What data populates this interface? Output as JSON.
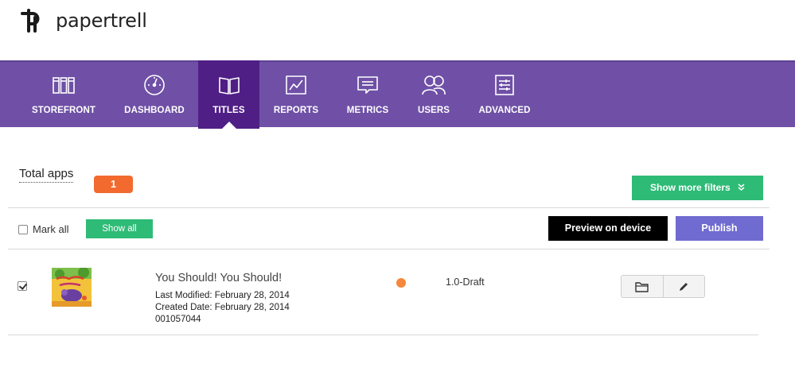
{
  "brand": {
    "name": "papertrell",
    "logo_icon": "papertrell-logo-icon"
  },
  "nav": {
    "items": [
      {
        "label": "STOREFRONT",
        "icon": "storefront-icon",
        "active": false
      },
      {
        "label": "DASHBOARD",
        "icon": "dashboard-gauge-icon",
        "active": false
      },
      {
        "label": "TITLES",
        "icon": "open-book-icon",
        "active": true
      },
      {
        "label": "REPORTS",
        "icon": "line-chart-icon",
        "active": false
      },
      {
        "label": "METRICS",
        "icon": "message-lines-icon",
        "active": false
      },
      {
        "label": "USERS",
        "icon": "users-icon",
        "active": false
      },
      {
        "label": "ADVANCED",
        "icon": "sliders-icon",
        "active": false
      }
    ],
    "colors": {
      "bar": "#6f50a6",
      "active": "#4f1f86"
    }
  },
  "summary": {
    "total_label": "Total apps",
    "total_count": "1",
    "filters_button": "Show more filters"
  },
  "actions": {
    "mark_all_label": "Mark all",
    "mark_all_checked": false,
    "show_all_button": "Show all",
    "preview_button": "Preview on device",
    "publish_button": "Publish"
  },
  "apps": [
    {
      "checked": true,
      "thumbnail": "book-cover-thumbnail",
      "title": "You Should! You Should!",
      "last_modified": "Last Modified: February 28, 2014",
      "created_date": "Created Date: February 28, 2014",
      "id": "001057044",
      "status_color": "#f5883a",
      "version": "1.0-Draft",
      "actions": [
        "folder-icon",
        "pencil-edit-icon"
      ]
    }
  ],
  "colors": {
    "green": "#2ebb76",
    "orange_badge": "#f26a2e",
    "publish": "#6f6bd0",
    "preview": "#000000"
  }
}
